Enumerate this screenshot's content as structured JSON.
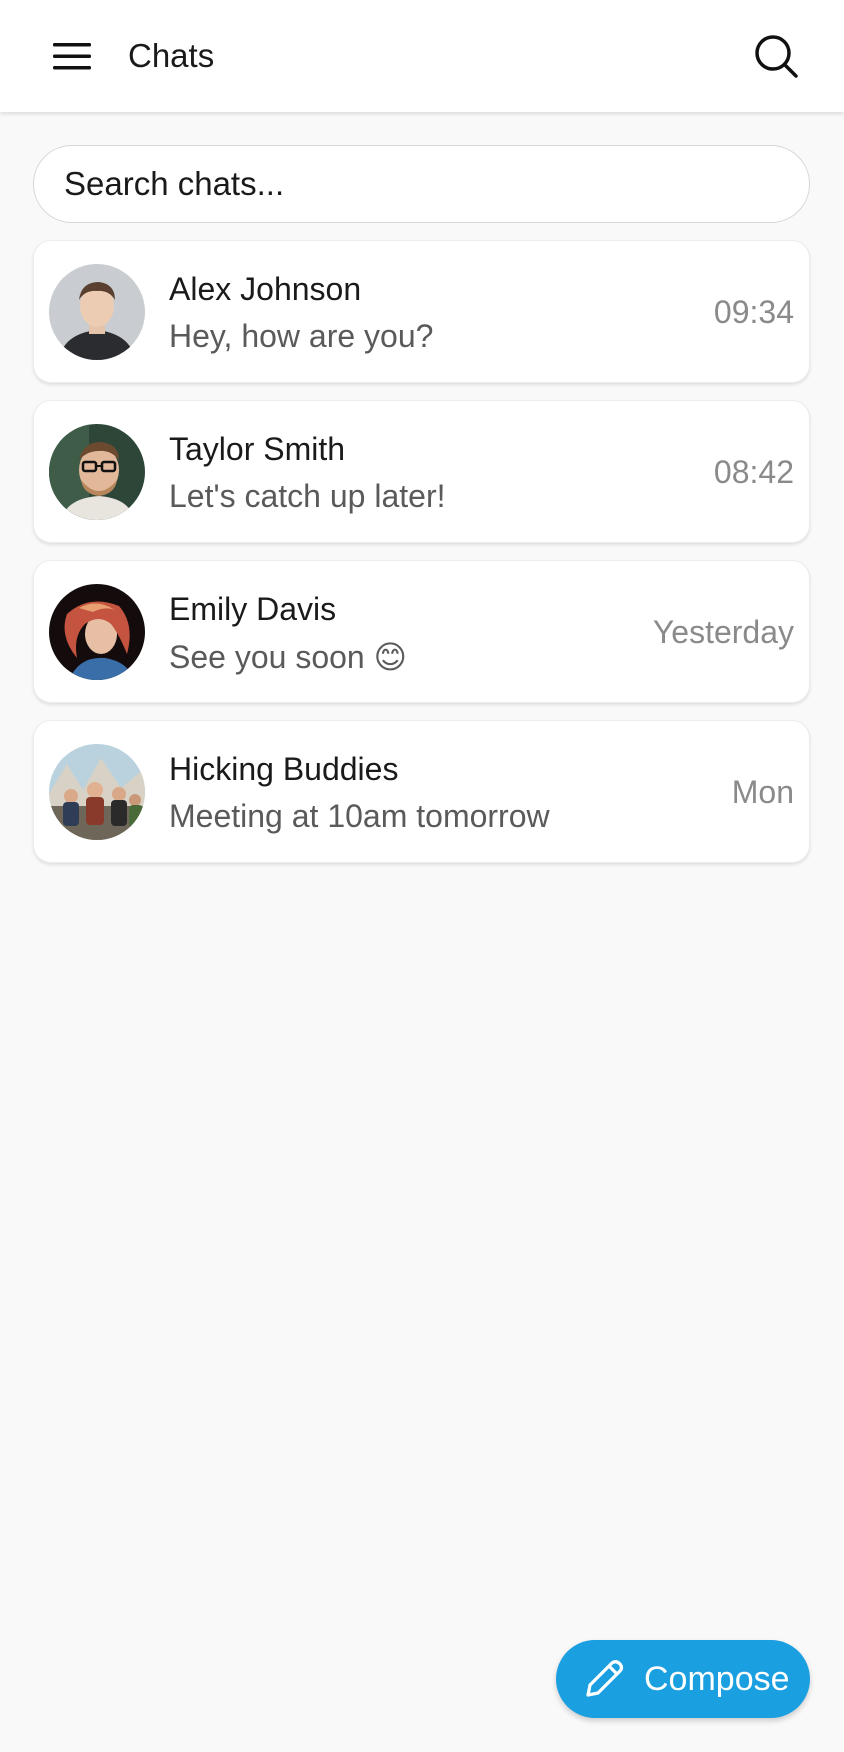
{
  "topbar": {
    "title": "Chats",
    "menu_icon": "menu-icon",
    "search_icon": "search-icon"
  },
  "search": {
    "placeholder": "Search chats...",
    "value": ""
  },
  "chats": [
    {
      "name": "Alex Johnson",
      "preview": "Hey, how are you?",
      "time": "09:34",
      "avatar": "avatar-photo"
    },
    {
      "name": "Taylor Smith",
      "preview": "Let's catch up later!",
      "time": "08:42",
      "avatar": "avatar-photo"
    },
    {
      "name": "Emily Davis",
      "preview": "See you soon 😊",
      "time": "Yesterday",
      "avatar": "avatar-photo"
    },
    {
      "name": "Hicking Buddies",
      "preview": "Meeting at 10am tomorrow",
      "time": "Mon",
      "avatar": "group-avatar-photo"
    }
  ],
  "fab": {
    "label": "Compose",
    "icon": "pencil-icon"
  },
  "colors": {
    "accent": "#1a9fe0",
    "background": "#f9f9f9",
    "card": "#ffffff",
    "time_text": "#8a8a8a",
    "preview_text": "#5a5a5a"
  }
}
